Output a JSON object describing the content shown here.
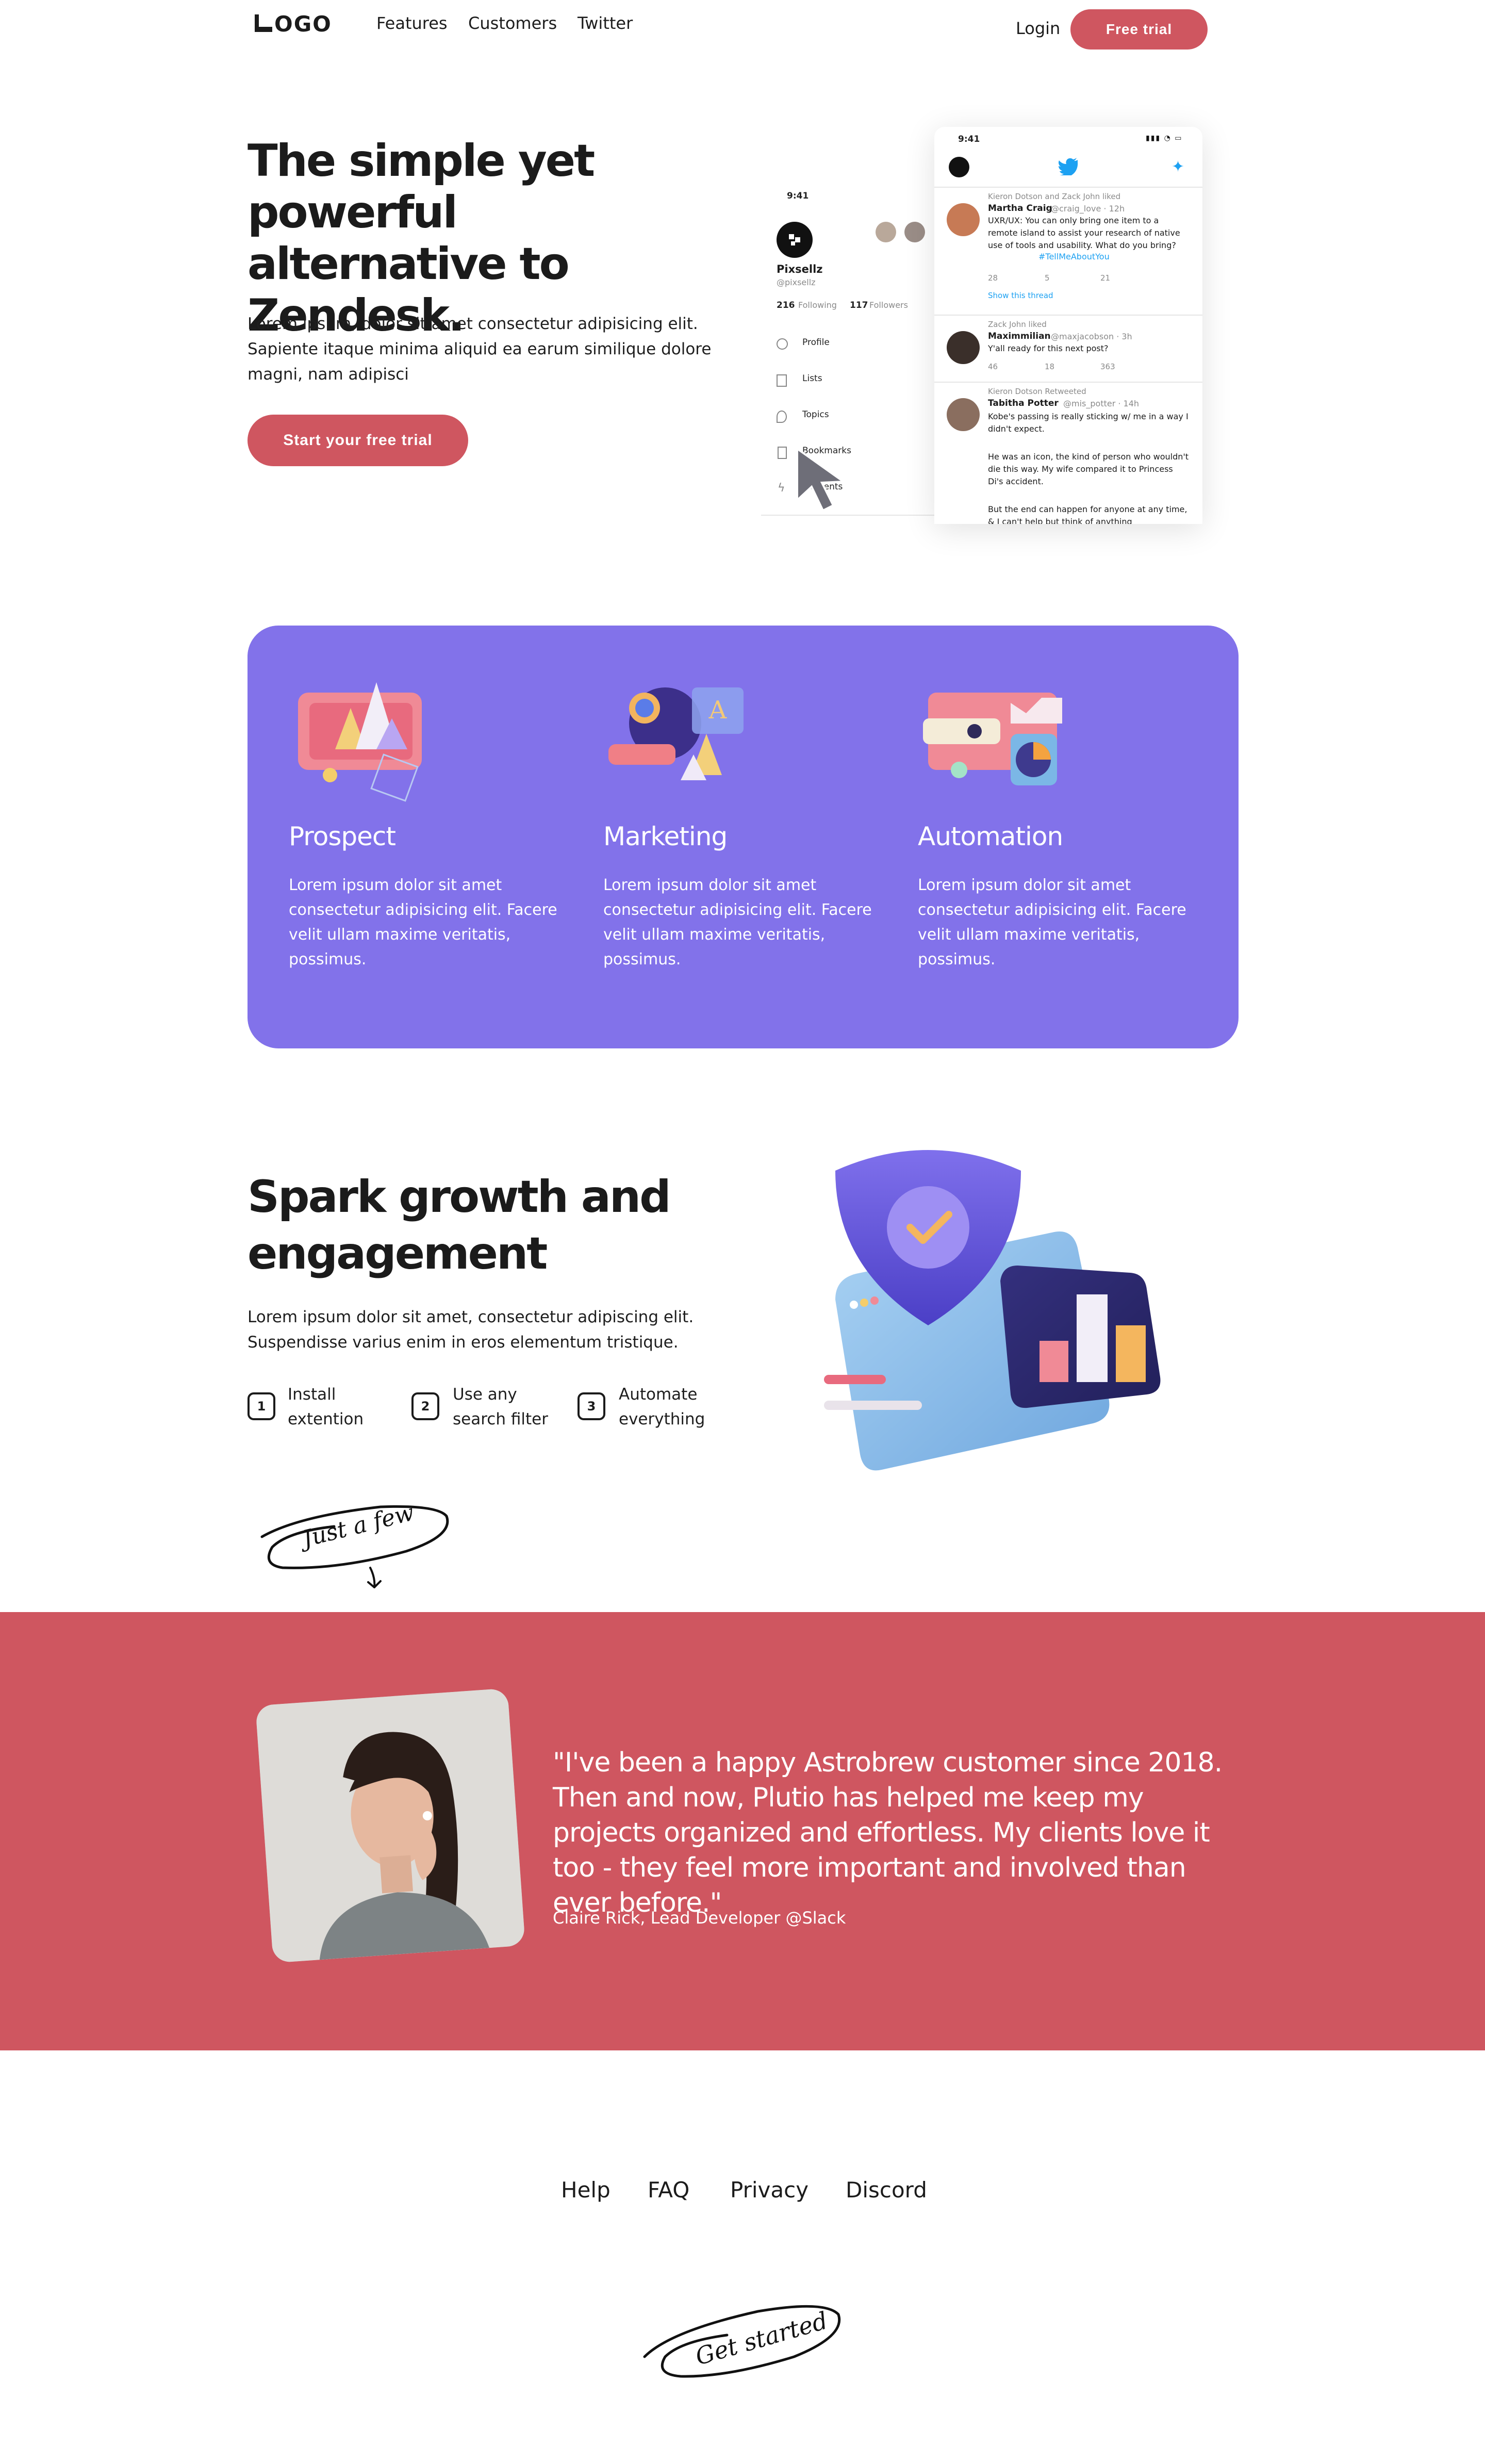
{
  "nav": {
    "logo": "LOGO",
    "links": [
      "Features",
      "Customers",
      "Twitter"
    ],
    "login": "Login",
    "trial": "Free trial"
  },
  "hero": {
    "title": "The simple yet powerful alternative to Zendesk.",
    "text": "Lorem ipsum, dolor sit amet consectetur adipisicing elit. Sapiente itaque minima aliquid ea earum similique dolore magni, nam adipisci",
    "cta": "Start your free trial"
  },
  "mock_profile": {
    "time": "9:41",
    "name": "Pixsellz",
    "handle": "@pixsellz",
    "following_count": "216",
    "following_label": "Following",
    "followers_count": "117",
    "followers_label": "Followers",
    "menu": [
      "Profile",
      "Lists",
      "Topics",
      "Bookmarks",
      "Moments"
    ]
  },
  "mock_feed": {
    "time": "9:41",
    "tweets": [
      {
        "context": "Kieron Dotson and Zack John liked",
        "name": "Martha Craig",
        "handle": "@craig_love · 12h",
        "text": "UXR/UX: You can only bring one item to a remote island to assist your research of native use of tools and usability. What do you bring?",
        "hashtag": "#TellMeAboutYou",
        "counts": [
          "28",
          "5",
          "21"
        ],
        "thread": "Show this thread"
      },
      {
        "context": "Zack John liked",
        "name": "Maximmilian",
        "handle": "@maxjacobson · 3h",
        "text": "Y'all ready for this next post?",
        "counts": [
          "46",
          "18",
          "363"
        ]
      },
      {
        "context": "Kieron Dotson Retweeted",
        "name": "Tabitha Potter",
        "handle": "@mis_potter · 14h",
        "text": "Kobe's passing is really sticking w/ me in a way I didn't expect.",
        "text2": "He was an icon, the kind of person who wouldn't die this way. My wife compared it to Princess Di's accident.",
        "text3": "But the end can happen for anyone at any time, & I can't help but think of anything"
      }
    ]
  },
  "features": [
    {
      "title": "Prospect",
      "text": "Lorem ipsum dolor sit amet consectetur adipisicing elit. Facere velit ullam maxime veritatis, possimus."
    },
    {
      "title": "Marketing",
      "text": "Lorem ipsum dolor sit amet consectetur adipisicing elit. Facere velit ullam maxime veritatis, possimus."
    },
    {
      "title": "Automation",
      "text": "Lorem ipsum dolor sit amet consectetur adipisicing elit. Facere velit ullam maxime veritatis, possimus."
    }
  ],
  "spark": {
    "title": "Spark growth and engagement",
    "text": "Lorem ipsum dolor sit amet, consectetur adipiscing elit. Suspendisse varius enim in eros elementum tristique.",
    "steps": [
      {
        "num": "1",
        "line1": "Install",
        "line2": "extention"
      },
      {
        "num": "2",
        "line1": "Use any",
        "line2": "search filter"
      },
      {
        "num": "3",
        "line1": "Automate",
        "line2": "everything"
      }
    ]
  },
  "handwritten": {
    "few": "Just a few",
    "started": "Get started"
  },
  "testimonial": {
    "quote": "\"I've been a happy Astrobrew customer since 2018. Then and now, Plutio has helped me keep my projects organized and effortless. My clients love it too - they feel more important and involved than ever before.\"",
    "author": "Claire Rick, Lead Developer @Slack"
  },
  "footer": {
    "links": [
      "Help",
      "FAQ",
      "Privacy",
      "Discord"
    ]
  },
  "colors": {
    "accent": "#cf5660",
    "purple": "#8272ea",
    "text": "#1b1b1b"
  }
}
